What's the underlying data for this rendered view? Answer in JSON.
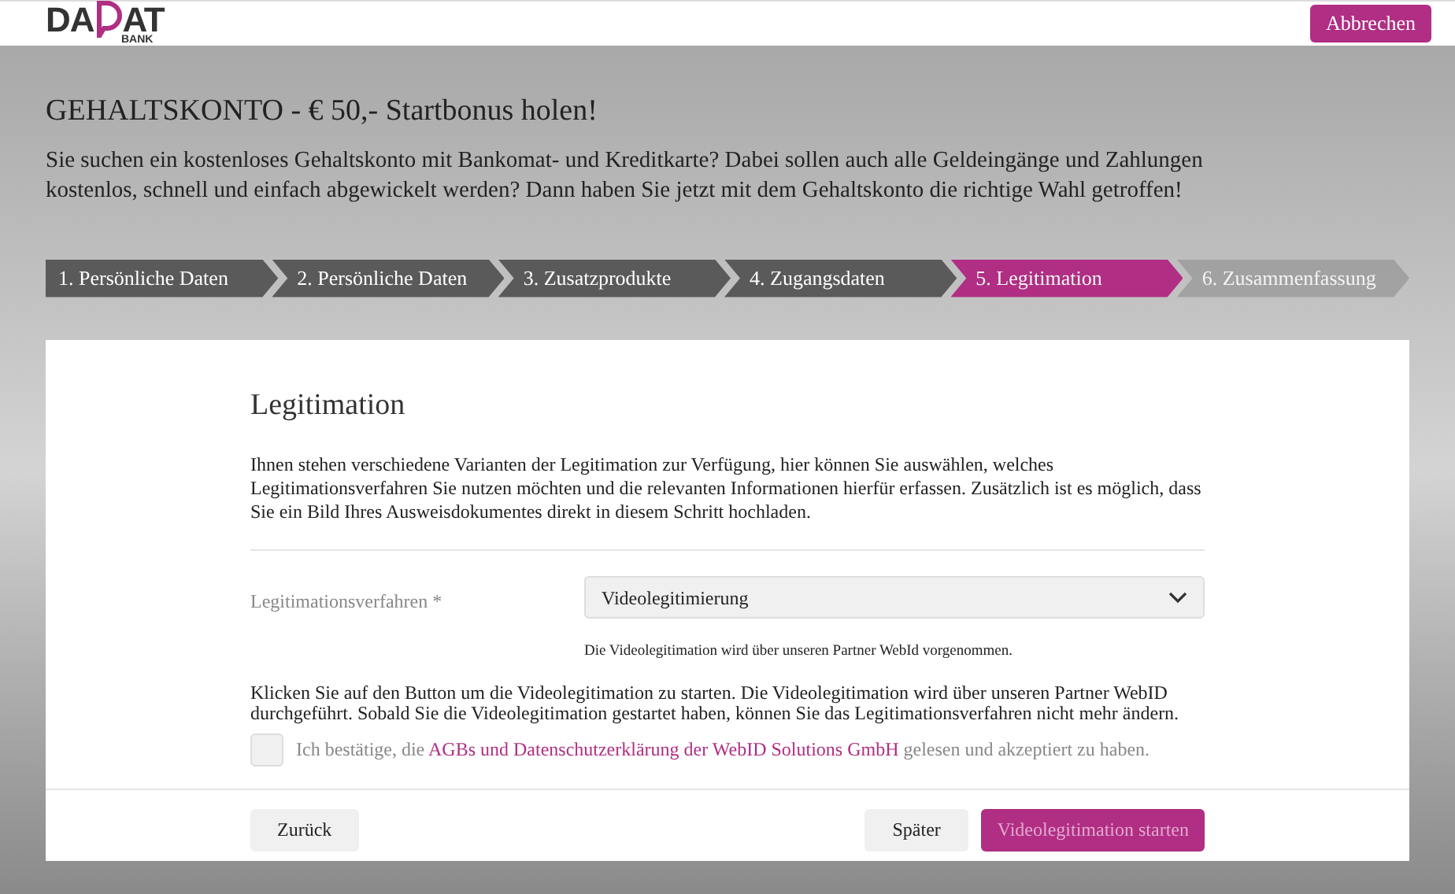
{
  "logo": {
    "left": "DA",
    "right": "AT",
    "sub": "BANK"
  },
  "cancel_button": "Abbrechen",
  "hero": {
    "title": "GEHALTSKONTO - € 50,- Startbonus holen!",
    "text": "Sie suchen ein kostenloses Gehaltskonto mit Bankomat- und Kreditkarte? Dabei sollen auch alle Geldeingänge und Zahlungen kostenlos, schnell und einfach abgewickelt werden? Dann haben Sie jetzt mit dem Gehaltskonto die richtige Wahl getroffen!"
  },
  "steps": [
    {
      "label": "1. Persönliche Daten",
      "completed": true,
      "selected": false
    },
    {
      "label": "2. Persönliche Daten",
      "completed": true,
      "selected": false
    },
    {
      "label": "3. Zusatzprodukte",
      "completed": true,
      "selected": false
    },
    {
      "label": "4. Zugangsdaten",
      "completed": true,
      "selected": false
    },
    {
      "label": "5. Legitimation",
      "completed": false,
      "selected": true
    },
    {
      "label": "6. Zusammenfassung",
      "completed": false,
      "selected": false
    }
  ],
  "form": {
    "title": "Legitimation",
    "intro": "Ihnen stehen verschiedene Varianten der Legitimation zur Verfügung, hier können Sie auswählen, welches Legitimationsverfahren Sie nutzen möchten und die relevanten Informationen hierfür erfassen. Zusätzlich ist es möglich, dass Sie ein Bild Ihres Ausweisdokumentes direkt in diesem Schritt hochladen.",
    "field_label": "Legitimationsverfahren *",
    "field_value": "Videolegitimierung",
    "field_hint": "Die Videolegitimation wird über unseren Partner WebId vorgenommen.",
    "notice": "Klicken Sie auf den Button um die Videolegitimation zu starten. Die Videolegitimation wird über unseren Partner WebID durchgeführt. Sobald Sie die Videolegitimation gestartet haben, können Sie das Legitimationsverfahren nicht mehr ändern.",
    "consent": {
      "checked": false,
      "before": "Ich bestätige, die",
      "link": "AGBs und Datenschutzerklärung der WebID Solutions GmbH",
      "after": "gelesen und akzeptiert zu haben."
    }
  },
  "buttons": {
    "back": "Zurück",
    "later": "Später",
    "start": {
      "label": "Videolegitimation starten",
      "disabled": true
    }
  }
}
